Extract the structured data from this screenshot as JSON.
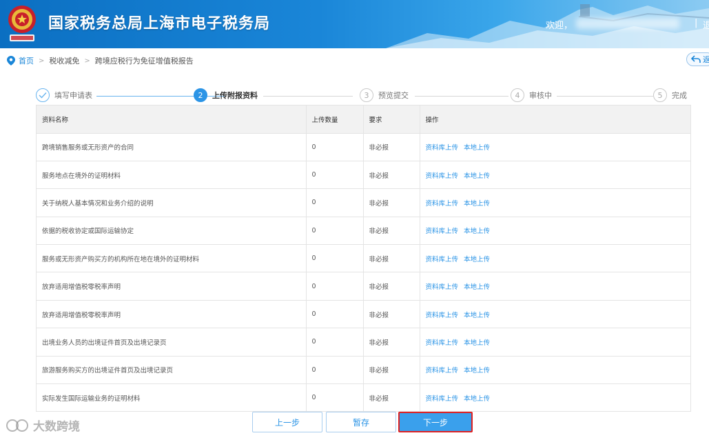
{
  "header": {
    "site_title": "国家税务总局上海市电子税务局",
    "welcome": "欢迎，",
    "separator": "|",
    "logout_partial": "退",
    "brand_color": "#1a86d8"
  },
  "breadcrumb": {
    "home": "首页",
    "level2": "税收减免",
    "level3": "跨境应税行为免征增值税报告",
    "sep": ">"
  },
  "back_button": {
    "label": "返",
    "icon": "back-arrow-icon"
  },
  "steps": [
    {
      "number": "✓",
      "label": "填写申请表",
      "state": "done"
    },
    {
      "number": "2",
      "label": "上传附报资料",
      "state": "active"
    },
    {
      "number": "3",
      "label": "预览提交",
      "state": "pending"
    },
    {
      "number": "4",
      "label": "审核中",
      "state": "pending"
    },
    {
      "number": "5",
      "label": "完成",
      "state": "pending"
    }
  ],
  "table": {
    "headers": [
      "资料名称",
      "上传数量",
      "要求",
      "操作"
    ],
    "rows": [
      {
        "name": "跨境销售服务或无形资产的合同",
        "count": "0",
        "requirement": "非必报",
        "action1": "资料库上传",
        "action2": "本地上传"
      },
      {
        "name": "服务地点在境外的证明材料",
        "count": "0",
        "requirement": "非必报",
        "action1": "资料库上传",
        "action2": "本地上传"
      },
      {
        "name": "关于纳税人基本情况和业务介绍的说明",
        "count": "0",
        "requirement": "非必报",
        "action1": "资料库上传",
        "action2": "本地上传"
      },
      {
        "name": "依据的税收协定或国际运输协定",
        "count": "0",
        "requirement": "非必报",
        "action1": "资料库上传",
        "action2": "本地上传"
      },
      {
        "name": "服务或无形资产购买方的机构所在地在境外的证明材料",
        "count": "0",
        "requirement": "非必报",
        "action1": "资料库上传",
        "action2": "本地上传"
      },
      {
        "name": "放弃适用增值税零税率声明",
        "count": "0",
        "requirement": "非必报",
        "action1": "资料库上传",
        "action2": "本地上传"
      },
      {
        "name": "放弃适用增值税零税率声明",
        "count": "0",
        "requirement": "非必报",
        "action1": "资料库上传",
        "action2": "本地上传"
      },
      {
        "name": "出境业务人员的出境证件首页及出境记录页",
        "count": "0",
        "requirement": "非必报",
        "action1": "资料库上传",
        "action2": "本地上传"
      },
      {
        "name": "旅游服务购买方的出境证件首页及出境记录页",
        "count": "0",
        "requirement": "非必报",
        "action1": "资料库上传",
        "action2": "本地上传"
      },
      {
        "name": "实际发生国际运输业务的证明材料",
        "count": "0",
        "requirement": "非必报",
        "action1": "资料库上传",
        "action2": "本地上传"
      }
    ]
  },
  "buttons": {
    "prev": "上一步",
    "save": "暂存",
    "next": "下一步"
  },
  "watermark": {
    "text": "大数跨境"
  }
}
